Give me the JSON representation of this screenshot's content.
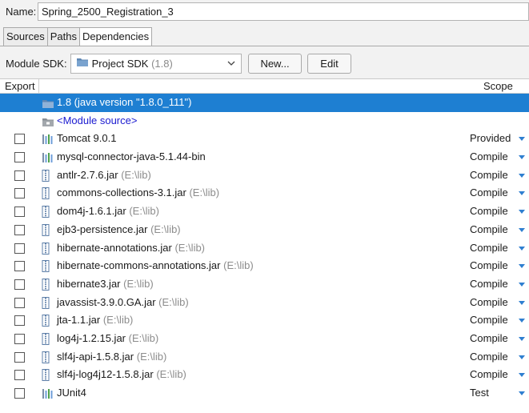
{
  "name_field": {
    "label": "Name:",
    "value": "Spring_2500_Registration_3"
  },
  "tabs": [
    {
      "label": "Sources",
      "active": false
    },
    {
      "label": "Paths",
      "active": false
    },
    {
      "label": "Dependencies",
      "active": true
    }
  ],
  "sdk": {
    "label": "Module SDK:",
    "selected_main": "Project SDK",
    "selected_version": "(1.8)",
    "new_button": "New...",
    "edit_button": "Edit"
  },
  "table": {
    "header_export": "Export",
    "header_scope": "Scope",
    "rows": [
      {
        "name": "1.8 (java version \"1.8.0_111\")",
        "path": "",
        "scope": "",
        "icon": "jdk-folder-icon",
        "checkbox": false,
        "selected": true
      },
      {
        "name": "<Module source>",
        "path": "",
        "scope": "",
        "icon": "module-source-icon",
        "checkbox": false,
        "link": true
      },
      {
        "name": "Tomcat 9.0.1",
        "path": "",
        "scope": "Provided",
        "icon": "library-icon",
        "checkbox": true
      },
      {
        "name": "mysql-connector-java-5.1.44-bin",
        "path": "",
        "scope": "Compile",
        "icon": "library-icon",
        "checkbox": true
      },
      {
        "name": "antlr-2.7.6.jar",
        "path": "(E:\\lib)",
        "scope": "Compile",
        "icon": "jar-icon",
        "checkbox": true
      },
      {
        "name": "commons-collections-3.1.jar",
        "path": "(E:\\lib)",
        "scope": "Compile",
        "icon": "jar-icon",
        "checkbox": true
      },
      {
        "name": "dom4j-1.6.1.jar",
        "path": "(E:\\lib)",
        "scope": "Compile",
        "icon": "jar-icon",
        "checkbox": true
      },
      {
        "name": "ejb3-persistence.jar",
        "path": "(E:\\lib)",
        "scope": "Compile",
        "icon": "jar-icon",
        "checkbox": true
      },
      {
        "name": "hibernate-annotations.jar",
        "path": "(E:\\lib)",
        "scope": "Compile",
        "icon": "jar-icon",
        "checkbox": true
      },
      {
        "name": "hibernate-commons-annotations.jar",
        "path": "(E:\\lib)",
        "scope": "Compile",
        "icon": "jar-icon",
        "checkbox": true
      },
      {
        "name": "hibernate3.jar",
        "path": "(E:\\lib)",
        "scope": "Compile",
        "icon": "jar-icon",
        "checkbox": true
      },
      {
        "name": "javassist-3.9.0.GA.jar",
        "path": "(E:\\lib)",
        "scope": "Compile",
        "icon": "jar-icon",
        "checkbox": true
      },
      {
        "name": "jta-1.1.jar",
        "path": "(E:\\lib)",
        "scope": "Compile",
        "icon": "jar-icon",
        "checkbox": true
      },
      {
        "name": "log4j-1.2.15.jar",
        "path": "(E:\\lib)",
        "scope": "Compile",
        "icon": "jar-icon",
        "checkbox": true
      },
      {
        "name": "slf4j-api-1.5.8.jar",
        "path": "(E:\\lib)",
        "scope": "Compile",
        "icon": "jar-icon",
        "checkbox": true
      },
      {
        "name": "slf4j-log4j12-1.5.8.jar",
        "path": "(E:\\lib)",
        "scope": "Compile",
        "icon": "jar-icon",
        "checkbox": true
      },
      {
        "name": "JUnit4",
        "path": "",
        "scope": "Test",
        "icon": "library-icon",
        "checkbox": true
      }
    ]
  },
  "colors": {
    "selection": "#1e7fd2",
    "link": "#1a1ad0",
    "caret": "#2f7fd0"
  }
}
